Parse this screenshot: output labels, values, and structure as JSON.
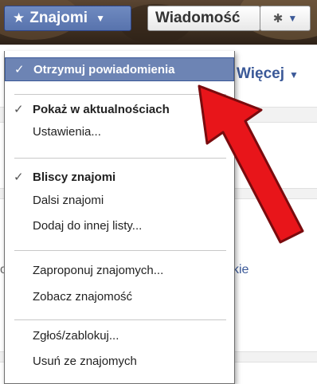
{
  "header": {
    "friends_button": {
      "label": "Znajomi",
      "icon": "star-icon",
      "caret": "▼"
    },
    "message_button": {
      "label": "Wiadomość"
    },
    "gear_button": {
      "icon": "gear-icon",
      "caret": "▼"
    }
  },
  "background": {
    "more_link": "Więcej",
    "more_caret": "▼",
    "partial_link": "kie",
    "partial_text": "o"
  },
  "menu": {
    "items": [
      {
        "label": "Otrzymuj powiadomienia",
        "checked": true,
        "check": "✓",
        "bold": true,
        "highlighted": true
      },
      {
        "label": "Pokaż w aktualnościach",
        "checked": true,
        "check": "✓",
        "bold": true
      },
      {
        "label": "Ustawienia..."
      },
      {
        "label": "Bliscy znajomi",
        "checked": true,
        "check": "✓",
        "bold": true
      },
      {
        "label": "Dalsi znajomi"
      },
      {
        "label": "Dodaj do innej listy..."
      },
      {
        "label": "Zaproponuj znajomych..."
      },
      {
        "label": "Zobacz znajomość"
      },
      {
        "label": "Zgłoś/zablokuj..."
      },
      {
        "label": "Usuń ze znajomych"
      }
    ]
  },
  "colors": {
    "brand": "#3b5998",
    "highlight": "#6d84b4",
    "arrow": "#e8151a"
  }
}
